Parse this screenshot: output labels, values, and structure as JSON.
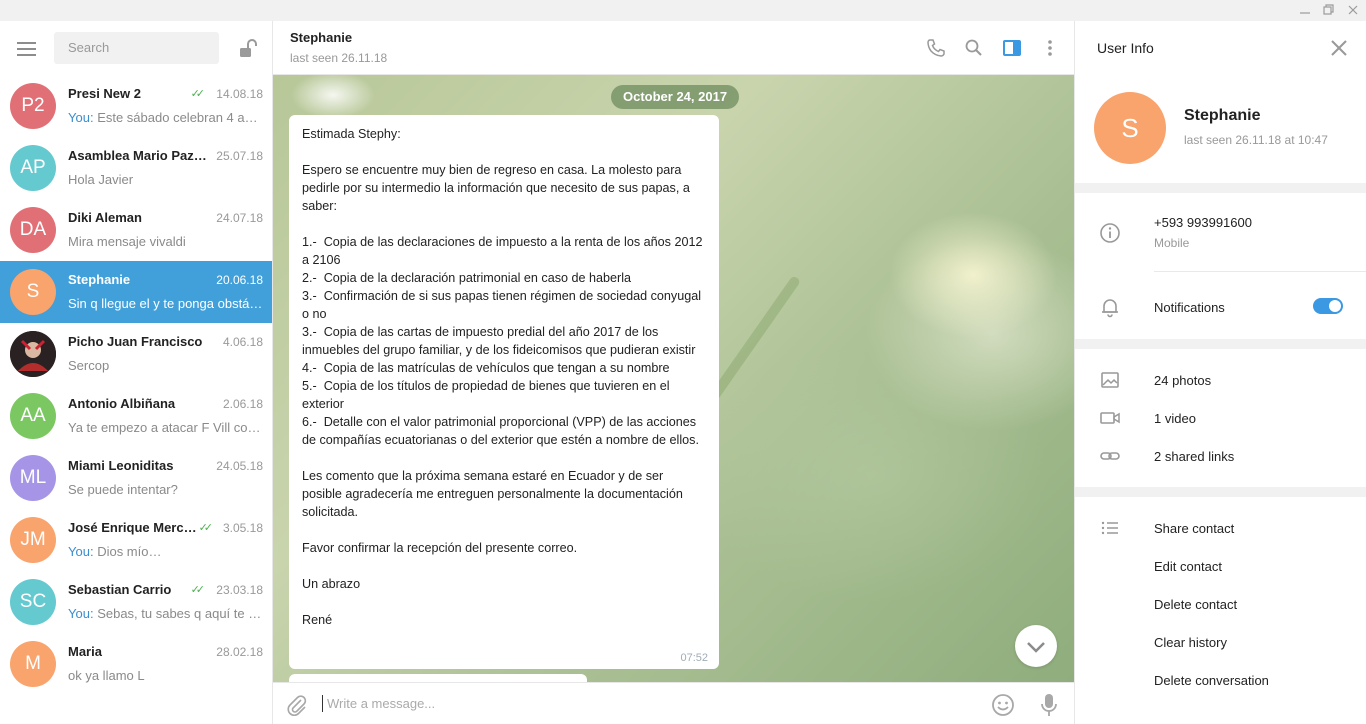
{
  "window": {
    "minimize_icon": "minimize-icon",
    "restore_icon": "restore-icon"
  },
  "sidebar": {
    "search_placeholder": "Search",
    "chats": [
      {
        "initials": "P2",
        "color": "#e17076",
        "name": "Presi New 2",
        "date": "14.08.18",
        "read": true,
        "you": "You:",
        "preview": "Este sábado celebran 4 a…"
      },
      {
        "initials": "AP",
        "color": "#65c9d0",
        "name": "Asamblea Mario Paz…",
        "date": "25.07.18",
        "read": false,
        "you": "",
        "preview": "Hola Javier"
      },
      {
        "initials": "DA",
        "color": "#e17076",
        "name": "Diki Aleman",
        "date": "24.07.18",
        "read": false,
        "you": "",
        "preview": "Mira mensaje vivaldi"
      },
      {
        "initials": "S",
        "color": "#f9a36d",
        "name": "Stephanie",
        "date": "20.06.18",
        "read": false,
        "you": "",
        "preview": "Sin q llegue el y te ponga obstá…",
        "active": true
      },
      {
        "initials": "",
        "color": "#3a2b2b",
        "name": "Picho Juan Francisco",
        "date": "4.06.18",
        "read": false,
        "you": "",
        "preview": "Sercop",
        "photo": true
      },
      {
        "initials": "AA",
        "color": "#7bc862",
        "name": "Antonio Albiñana",
        "date": "2.06.18",
        "read": false,
        "you": "",
        "preview": "Ya te empezo a atacar F Vill con…"
      },
      {
        "initials": "ML",
        "color": "#a695e7",
        "name": "Miami Leoniditas",
        "date": "24.05.18",
        "read": false,
        "you": "",
        "preview": "Se puede intentar?"
      },
      {
        "initials": "JM",
        "color": "#f9a36d",
        "name": "José Enrique Merc…",
        "date": "3.05.18",
        "read": true,
        "you": "You:",
        "preview": "Dios mío…"
      },
      {
        "initials": "SC",
        "color": "#65c9d0",
        "name": "Sebastian Carrio",
        "date": "23.03.18",
        "read": true,
        "you": "You:",
        "preview": "Sebas, tu sabes q aquí te q…"
      },
      {
        "initials": "M",
        "color": "#f9a36d",
        "name": "Maria",
        "date": "28.02.18",
        "read": false,
        "you": "",
        "preview": "ok ya llamo L"
      }
    ]
  },
  "header": {
    "name": "Stephanie",
    "status": "last seen 26.11.18"
  },
  "conversation": {
    "date_pill": "October 24, 2017",
    "message": "Estimada Stephy:\n\nEspero se encuentre muy bien de regreso en casa. La molesto para pedirle por su intermedio la información que necesito de sus papas, a saber:\n\n1.-  Copia de las declaraciones de impuesto a la renta de los años 2012 a 2106\n2.-  Copia de la declaración patrimonial en caso de haberla\n3.-  Confirmación de si sus papas tienen régimen de sociedad conyugal o no\n3.-  Copia de las cartas de impuesto predial del año 2017 de los inmuebles del grupo familiar, y de los fideicomisos que pudieran existir\n4.-  Copia de las matrículas de vehículos que tengan a su nombre\n5.-  Copia de los títulos de propiedad de bienes que tuvieren en el exterior\n6.-  Detalle con el valor patrimonial proporcional (VPP) de las acciones de compañías ecuatorianas o del exterior que estén a nombre de ellos.\n\nLes comento que la próxima semana estaré en Ecuador y de ser posible agradecería me entreguen personalmente la documentación solicitada.\n\nFavor confirmar la recepción del presente correo.\n\nUn abrazo\n\nRené",
    "time": "07:52",
    "input_placeholder": "Write a message..."
  },
  "user_info": {
    "title": "User Info",
    "initial": "S",
    "name": "Stephanie",
    "last_seen": "last seen 26.11.18 at 10:47",
    "phone": "+593 993991600",
    "phone_label": "Mobile",
    "notifications_label": "Notifications",
    "notifications_on": true,
    "photos": "24 photos",
    "videos": "1 video",
    "links": "2 shared links",
    "actions": [
      "Share contact",
      "Edit contact",
      "Delete contact",
      "Clear history",
      "Delete conversation"
    ],
    "accent": "#3b98e2"
  }
}
